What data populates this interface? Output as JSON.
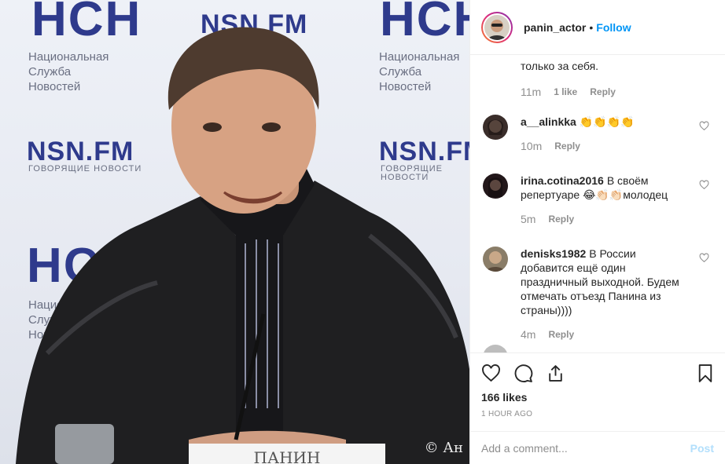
{
  "photo": {
    "banners": {
      "hcn": "НСН",
      "nsnfm": "NSN.FM",
      "sub_lines": [
        "Национальная",
        "Служба",
        "Новостей"
      ],
      "tagline": "ГОВОРЯЩИЕ НОВОСТИ",
      "nameplate": "ПАНИН"
    },
    "watermark": "© Ан"
  },
  "header": {
    "username": "panin_actor",
    "separator": "•",
    "follow_label": "Follow"
  },
  "comments": [
    {
      "user": "",
      "text": "только за себя.",
      "time": "11m",
      "likes": "1 like",
      "reply": "Reply"
    },
    {
      "user": "a__alinkka",
      "text": "👏👏👏👏",
      "time": "10m",
      "reply": "Reply"
    },
    {
      "user": "irina.cotina2016",
      "text": "В своём репертуаре 😂👏🏻👏🏻молодец",
      "time": "5m",
      "reply": "Reply"
    },
    {
      "user": "denisks1982",
      "text": "В России добавится ещё один праздничный выходной. Будем отмечать отъезд Панина из страны))))",
      "time": "4m",
      "reply": "Reply"
    }
  ],
  "actions": {
    "likes": "166 likes",
    "time_ago": "1 HOUR AGO"
  },
  "add_comment": {
    "placeholder": "Add a comment...",
    "post_label": "Post"
  },
  "colors": {
    "accent": "#0095f6",
    "post_disabled": "#b2dffc",
    "banner_blue": "#2e3a8c"
  },
  "icons": [
    "heart-icon",
    "comment-icon",
    "share-icon",
    "bookmark-icon",
    "small-heart-icon"
  ]
}
